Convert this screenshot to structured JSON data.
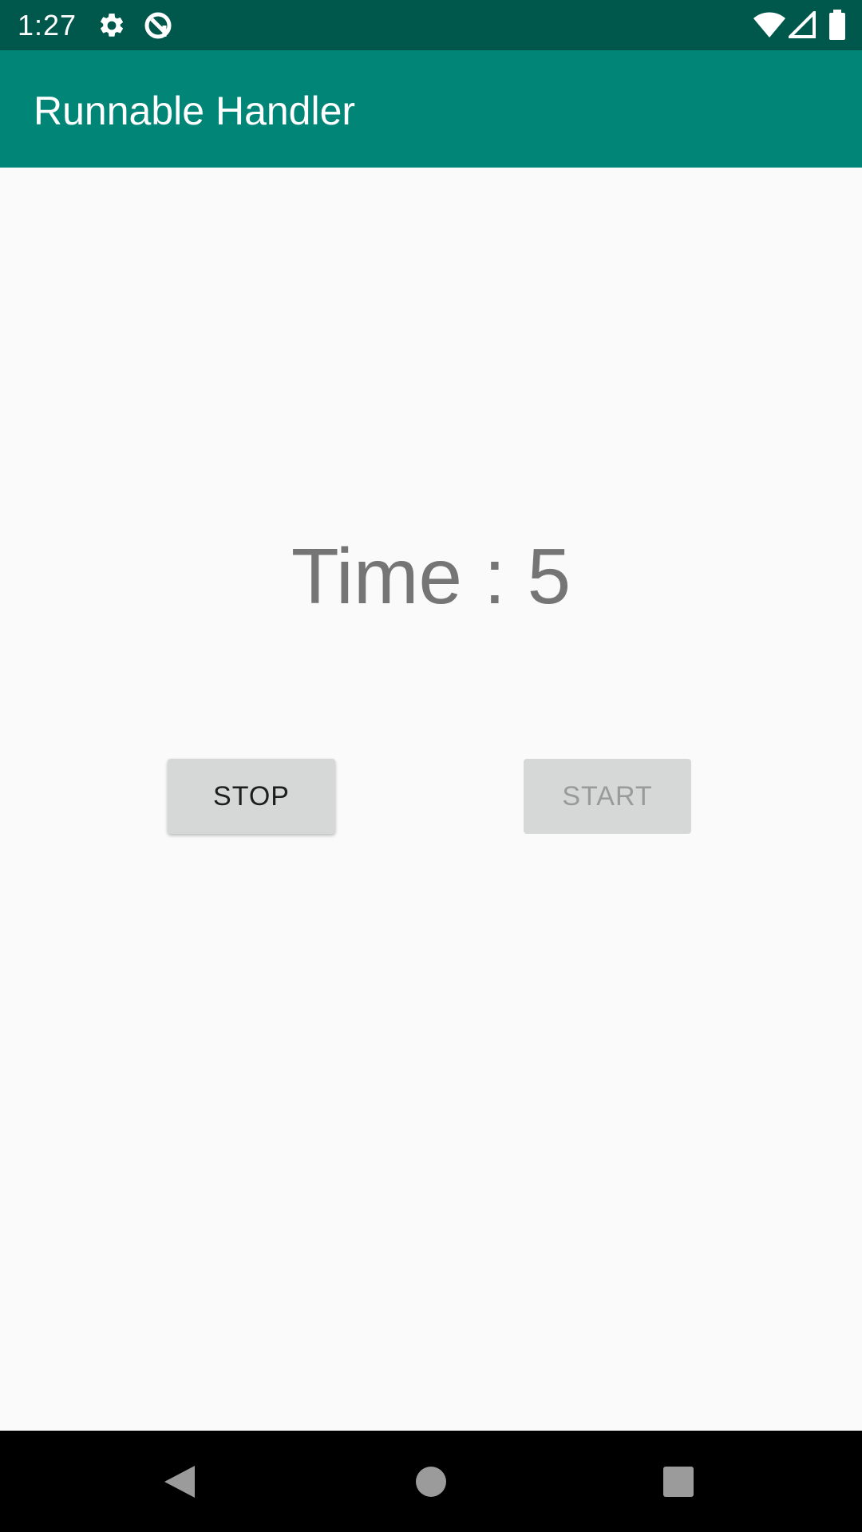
{
  "status_bar": {
    "time": "1:27",
    "icons": [
      "settings-icon",
      "data-saver-icon",
      "wifi-icon",
      "signal-icon",
      "battery-icon"
    ]
  },
  "app_bar": {
    "title": "Runnable Handler",
    "color": "#008577"
  },
  "main": {
    "time_text": "Time : 5",
    "stop_label": "STOP",
    "start_label": "START",
    "start_enabled": false
  },
  "nav_bar": {
    "icons": [
      "back-icon",
      "home-icon",
      "recents-icon"
    ]
  }
}
